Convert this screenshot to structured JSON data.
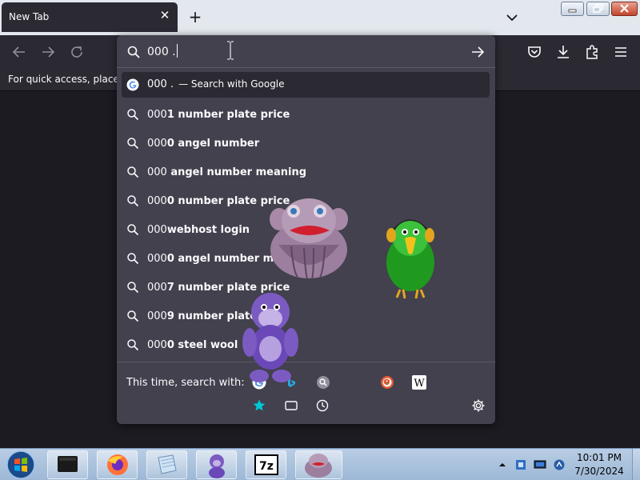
{
  "tabs": [
    {
      "title": "New Tab"
    }
  ],
  "bookmarks_bar": {
    "hint": "For quick access, place yo"
  },
  "urlbar": {
    "input_value": "000 .",
    "heuristic": {
      "text": "000 .",
      "action": "— Search with Google"
    },
    "suggestions": [
      {
        "typed": "000",
        "rest": "1 number plate price"
      },
      {
        "typed": "000",
        "rest": "0 angel number"
      },
      {
        "typed": "000",
        "rest": " angel number meaning"
      },
      {
        "typed": "000",
        "rest": "0 number plate price"
      },
      {
        "typed": "000",
        "rest": "webhost login"
      },
      {
        "typed": "000",
        "rest": "0 angel number me"
      },
      {
        "typed": "000",
        "rest": "7 number plate price"
      },
      {
        "typed": "000",
        "rest": "9 number plate p"
      },
      {
        "typed": "000",
        "rest": "0 steel wool"
      }
    ],
    "oneoff_label": "This time, search with:",
    "engines": [
      "google-icon",
      "bing-icon",
      "search-engine-icon",
      "duckduckgo-icon",
      "wikipedia-icon"
    ],
    "wikipedia_glyph": "W"
  },
  "taskbar": {
    "time": "10:01 PM",
    "date": "7/30/2024",
    "apps": [
      "terminal-icon",
      "firefox-icon",
      "notepad-icon",
      "bonzi-buddy-icon",
      "7zip-icon",
      "purple-blob-icon"
    ],
    "sevenzip_label": "7z"
  },
  "colors": {
    "accent": "#0060df",
    "panel": "#42414d",
    "toolbar": "#2b2a33",
    "background": "#1c1b22",
    "star_blue": "#00c8d7"
  }
}
